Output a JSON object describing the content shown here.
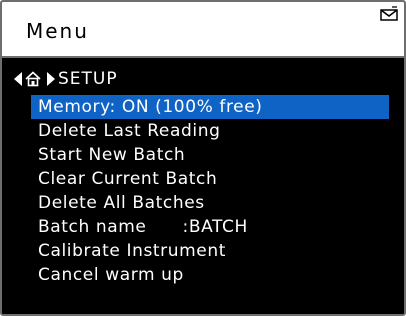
{
  "header": {
    "title": "Menu",
    "icon": "mail-icon"
  },
  "breadcrumb": {
    "back_icon": "left-arrow-icon",
    "home_icon": "home-icon",
    "separator_icon": "right-arrow-icon",
    "label": "SETUP"
  },
  "menu": {
    "selected_index": 0,
    "highlight_color": "#0f63c4",
    "items": [
      "Memory: ON (100% free)",
      "Delete Last Reading",
      "Start New Batch",
      "Clear Current Batch",
      "Delete All Batches",
      "Batch name      :BATCH",
      "Calibrate Instrument",
      "Cancel warm up"
    ]
  }
}
